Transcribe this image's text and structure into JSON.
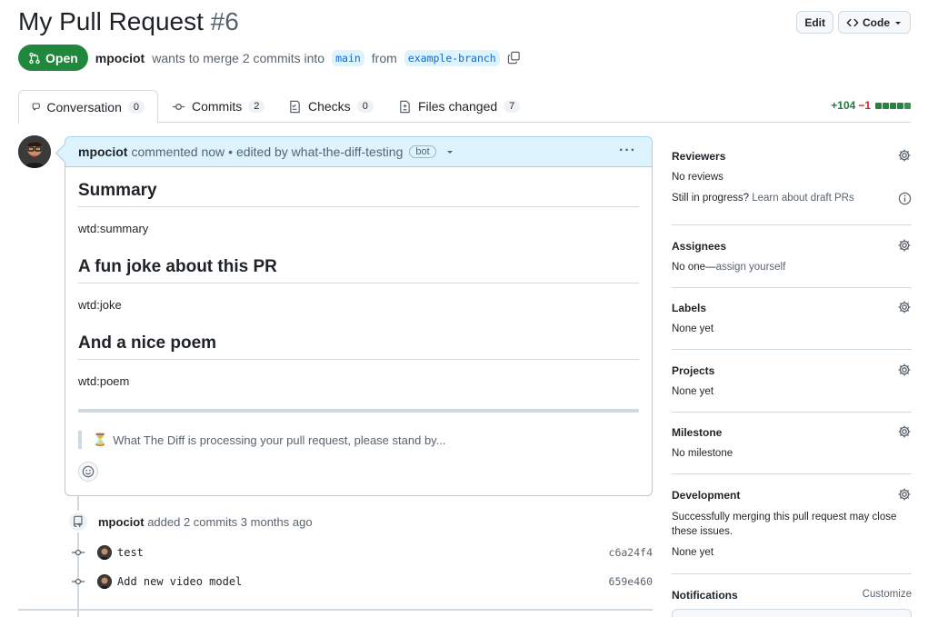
{
  "header": {
    "title": "My Pull Request",
    "number": "#6",
    "edit_label": "Edit",
    "code_label": "Code"
  },
  "meta": {
    "state": "Open",
    "author": "mpociot",
    "text_middle": "wants to merge 2 commits into",
    "base_branch": "main",
    "text_from": "from",
    "head_branch": "example-branch"
  },
  "tabs": [
    {
      "label": "Conversation",
      "count": "0"
    },
    {
      "label": "Commits",
      "count": "2"
    },
    {
      "label": "Checks",
      "count": "0"
    },
    {
      "label": "Files changed",
      "count": "7"
    }
  ],
  "diffstat": {
    "additions": "+104",
    "deletions": "−1"
  },
  "comment": {
    "author": "mpociot",
    "commented": "commented now",
    "edited": "• edited by what-the-diff-testing",
    "badge": "bot",
    "sections": [
      {
        "heading": "Summary",
        "text": "wtd:summary"
      },
      {
        "heading": "A fun joke about this PR",
        "text": "wtd:joke"
      },
      {
        "heading": "And a nice poem",
        "text": "wtd:poem"
      }
    ],
    "quote_icon": "⏳",
    "quote": "What The Diff is processing your pull request, please stand by..."
  },
  "event": {
    "author": "mpociot",
    "text": "added 2 commits 3 months ago"
  },
  "commits": [
    {
      "message": "test",
      "sha": "c6a24f4"
    },
    {
      "message": "Add new video model",
      "sha": "659e460"
    }
  ],
  "sidebar": {
    "reviewers": {
      "title": "Reviewers",
      "value": "No reviews",
      "hint": "Still in progress?",
      "hint_link": "Learn about draft PRs"
    },
    "assignees": {
      "title": "Assignees",
      "value_prefix": "No one—",
      "value_link": "assign yourself"
    },
    "labels": {
      "title": "Labels",
      "value": "None yet"
    },
    "projects": {
      "title": "Projects",
      "value": "None yet"
    },
    "milestone": {
      "title": "Milestone",
      "value": "No milestone"
    },
    "development": {
      "title": "Development",
      "text": "Successfully merging this pull request may close these issues.",
      "value": "None yet"
    },
    "notifications": {
      "title": "Notifications",
      "action": "Customize"
    }
  },
  "colors": {
    "open": "#1f883d",
    "accent": "#0969da",
    "comment_header": "#ddf4ff"
  }
}
